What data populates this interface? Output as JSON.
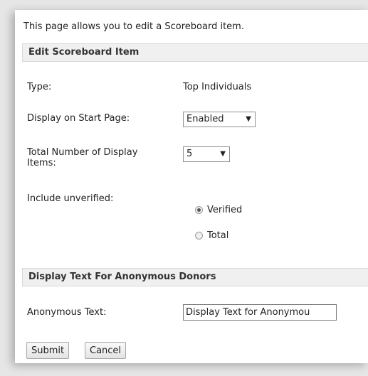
{
  "intro_text": "This page allows you to edit a Scoreboard item.",
  "section1": {
    "title": "Edit Scoreboard Item",
    "type_label": "Type:",
    "type_value": "Top Individuals",
    "display_label": "Display on Start Page:",
    "display_value": "Enabled",
    "total_label": "Total Number of Display Items:",
    "total_value": "5",
    "include_label": "Include unverified:",
    "radio_options": [
      "Verified",
      "Total"
    ],
    "radio_selected": "Verified"
  },
  "section2": {
    "title": "Display Text For Anonymous Donors",
    "anon_label": "Anonymous Text:",
    "anon_value": "Display Text for Anonymou"
  },
  "buttons": {
    "submit": "Submit",
    "cancel": "Cancel"
  },
  "icons": {
    "dropdown_arrow": "▼"
  }
}
